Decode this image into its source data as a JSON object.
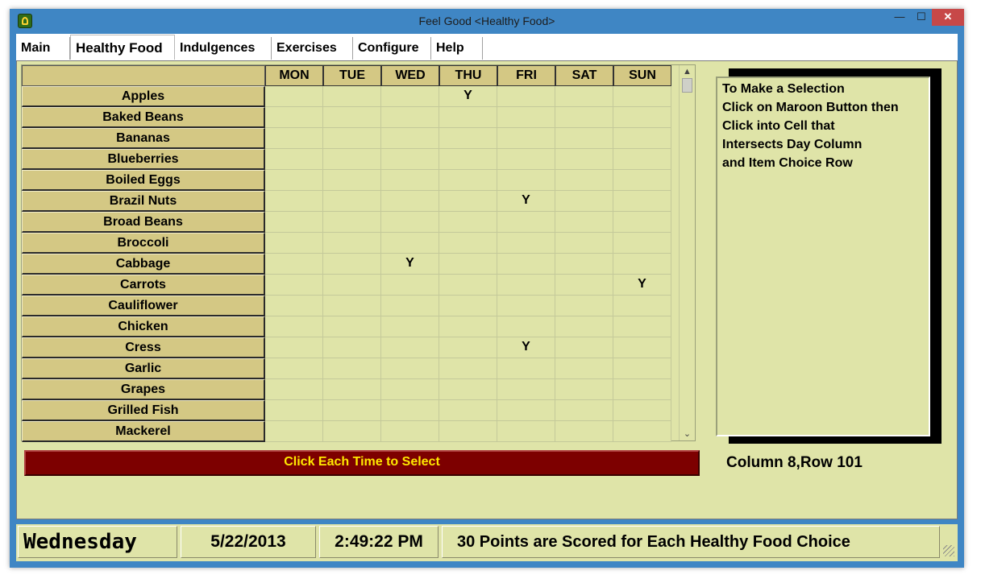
{
  "window": {
    "title": "Feel Good <Healthy Food>",
    "minimize_glyph": "—",
    "maximize_glyph": "☐",
    "close_glyph": "✕"
  },
  "menu": {
    "tabs": [
      {
        "label": "Main",
        "active": false
      },
      {
        "label": "Healthy Food",
        "active": true
      },
      {
        "label": "Indulgences",
        "active": false
      },
      {
        "label": "Exercises",
        "active": false
      },
      {
        "label": "Configure",
        "active": false
      },
      {
        "label": "Help",
        "active": false
      }
    ]
  },
  "grid": {
    "days": [
      "MON",
      "TUE",
      "WED",
      "THU",
      "FRI",
      "SAT",
      "SUN"
    ],
    "rows": [
      {
        "food": "Apples",
        "cells": [
          "",
          "",
          "",
          "Y",
          "",
          "",
          ""
        ]
      },
      {
        "food": "Baked Beans",
        "cells": [
          "",
          "",
          "",
          "",
          "",
          "",
          ""
        ]
      },
      {
        "food": "Bananas",
        "cells": [
          "",
          "",
          "",
          "",
          "",
          "",
          ""
        ]
      },
      {
        "food": "Blueberries",
        "cells": [
          "",
          "",
          "",
          "",
          "",
          "",
          ""
        ]
      },
      {
        "food": "Boiled Eggs",
        "cells": [
          "",
          "",
          "",
          "",
          "",
          "",
          ""
        ]
      },
      {
        "food": "Brazil Nuts",
        "cells": [
          "",
          "",
          "",
          "",
          "Y",
          "",
          ""
        ]
      },
      {
        "food": "Broad Beans",
        "cells": [
          "",
          "",
          "",
          "",
          "",
          "",
          ""
        ]
      },
      {
        "food": "Broccoli",
        "cells": [
          "",
          "",
          "",
          "",
          "",
          "",
          ""
        ]
      },
      {
        "food": "Cabbage",
        "cells": [
          "",
          "",
          "Y",
          "",
          "",
          "",
          ""
        ]
      },
      {
        "food": "Carrots",
        "cells": [
          "",
          "",
          "",
          "",
          "",
          "",
          "Y"
        ]
      },
      {
        "food": "Cauliflower",
        "cells": [
          "",
          "",
          "",
          "",
          "",
          "",
          ""
        ]
      },
      {
        "food": "Chicken",
        "cells": [
          "",
          "",
          "",
          "",
          "",
          "",
          ""
        ]
      },
      {
        "food": "Cress",
        "cells": [
          "",
          "",
          "",
          "",
          "Y",
          "",
          ""
        ]
      },
      {
        "food": "Garlic",
        "cells": [
          "",
          "",
          "",
          "",
          "",
          "",
          ""
        ]
      },
      {
        "food": "Grapes",
        "cells": [
          "",
          "",
          "",
          "",
          "",
          "",
          ""
        ]
      },
      {
        "food": "Grilled Fish",
        "cells": [
          "",
          "",
          "",
          "",
          "",
          "",
          ""
        ]
      },
      {
        "food": "Mackerel",
        "cells": [
          "",
          "",
          "",
          "",
          "",
          "",
          ""
        ]
      }
    ],
    "scroll_up_glyph": "▲",
    "scroll_down_glyph": "⌄"
  },
  "select_button_label": "Click Each Time to Select",
  "selection_position": "Column 8,Row 101",
  "instructions": [
    "To Make a Selection",
    "Click on Maroon Button then",
    "Click into Cell that",
    "Intersects Day Column",
    "and Item Choice Row"
  ],
  "status": {
    "day": "Wednesday",
    "date": "5/22/2013",
    "time": "2:49:22 PM",
    "message": "30 Points are Scored for Each Healthy Food Choice"
  },
  "colors": {
    "panel_background": "#dfe4a8",
    "header_background": "#d4c884",
    "select_button_background": "#7d0000",
    "select_button_text": "#ffe800",
    "window_frame": "#3f86c4"
  }
}
